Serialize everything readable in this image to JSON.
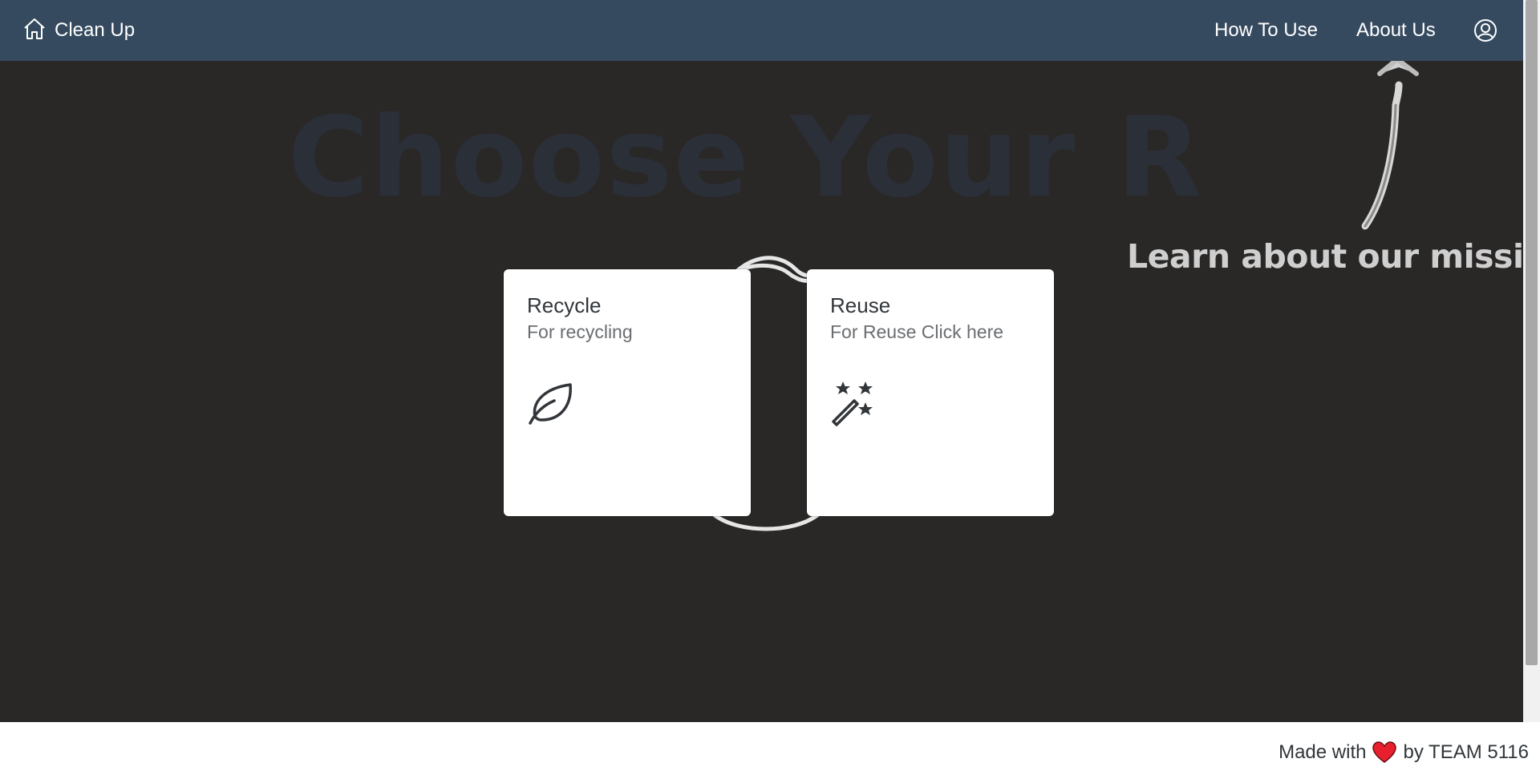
{
  "header": {
    "home_label": "Clean Up",
    "nav": [
      {
        "label": "How To Use"
      },
      {
        "label": "About Us"
      }
    ],
    "profile_icon": "user-circle-icon",
    "background_color": "#354a5f"
  },
  "hero": {
    "watermark_text": "Choose Your R",
    "mission_text": "Learn about our mission"
  },
  "tiles": [
    {
      "title": "Recycle",
      "subtitle": "For recycling",
      "icon": "leaf-icon"
    },
    {
      "title": "Reuse",
      "subtitle": "For Reuse Click here",
      "icon": "magic-wand-icon"
    }
  ],
  "footer": {
    "made_with": "Made with",
    "by_team": "by TEAM 5116",
    "heart_color": "#e8202e"
  }
}
